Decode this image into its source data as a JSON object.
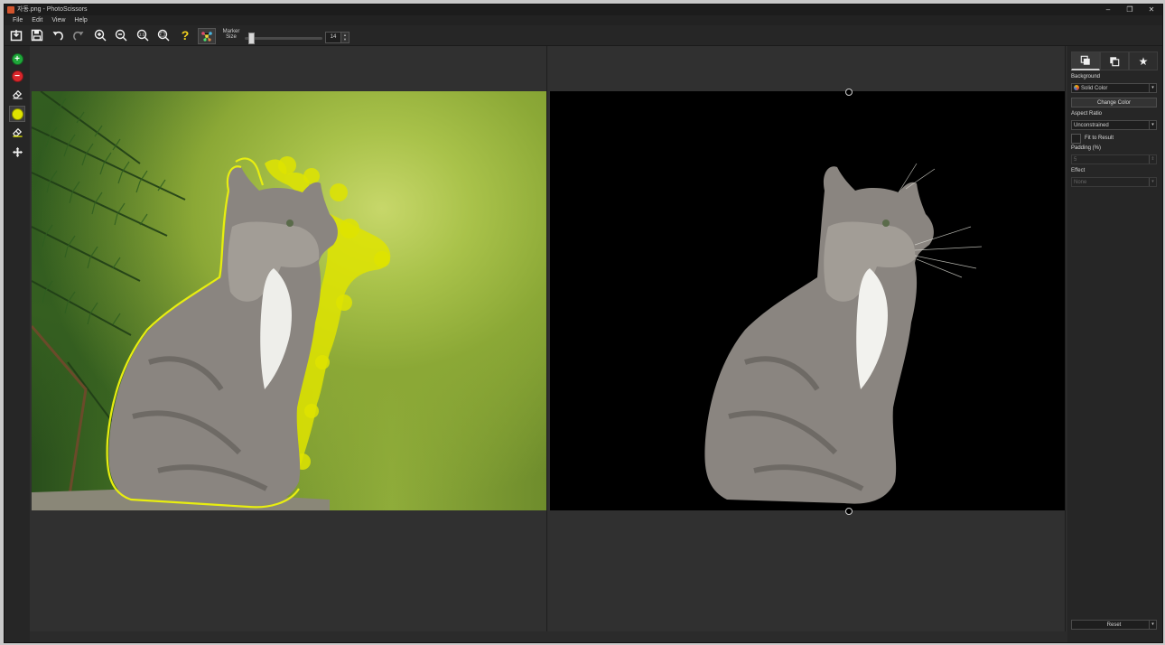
{
  "window": {
    "title": "자동.png - PhotoScissors",
    "controls": [
      "–",
      "❐",
      "✕"
    ]
  },
  "menu": [
    "File",
    "Edit",
    "View",
    "Help"
  ],
  "toolbar": {
    "help_label": "?",
    "marker_label_1": "Marker",
    "marker_label_2": "Size",
    "marker_size": "14",
    "marker_slider_fraction": 0.05
  },
  "panel": {
    "background_label": "Background",
    "background_value": "Solid Color",
    "change_color_label": "Change Color",
    "aspect_label": "Aspect Ratio",
    "aspect_value": "Unconstrained",
    "fit_label": "Fit to Result",
    "padding_label": "Padding (%)",
    "padding_value": "5",
    "effect_label": "Effect",
    "effect_value": "None",
    "reset_label": "Reset"
  },
  "colors": {
    "marker_keep": "#dfe400",
    "add_tool": "#1fa83a",
    "remove_tool": "#d9262b"
  }
}
